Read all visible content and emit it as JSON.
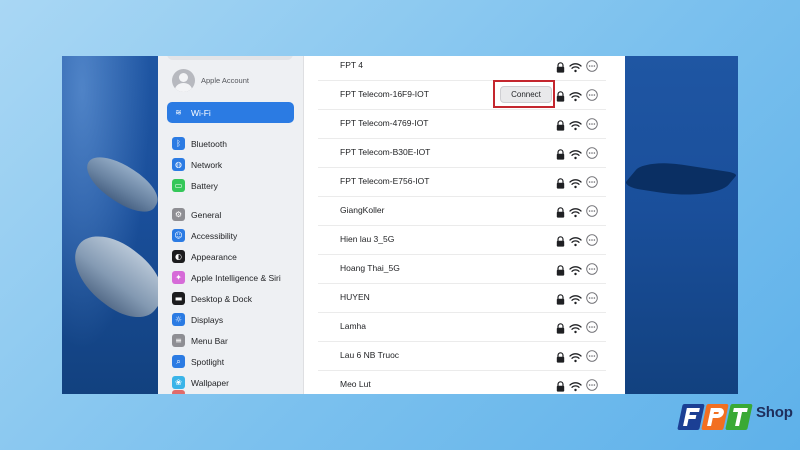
{
  "sidebar": {
    "account": {
      "label": "Apple Account"
    },
    "items": [
      {
        "label": "Wi-Fi",
        "icon": "wifi-icon",
        "color": "#2b7be3",
        "active": true
      },
      {
        "label": "Bluetooth",
        "icon": "bluetooth-icon",
        "color": "#2b7be3"
      },
      {
        "label": "Network",
        "icon": "globe-icon",
        "color": "#2b7be3"
      },
      {
        "label": "Battery",
        "icon": "battery-icon",
        "color": "#34c759"
      },
      {
        "label": "General",
        "icon": "gear-icon",
        "color": "#8e8e93"
      },
      {
        "label": "Accessibility",
        "icon": "accessibility-icon",
        "color": "#2b7be3"
      },
      {
        "label": "Appearance",
        "icon": "appearance-icon",
        "color": "#1c1c1e"
      },
      {
        "label": "Apple Intelligence & Siri",
        "icon": "siri-icon",
        "color": "#d66bd8"
      },
      {
        "label": "Desktop & Dock",
        "icon": "dock-icon",
        "color": "#1c1c1e"
      },
      {
        "label": "Displays",
        "icon": "display-icon",
        "color": "#2b7be3"
      },
      {
        "label": "Menu Bar",
        "icon": "menubar-icon",
        "color": "#8e8e93"
      },
      {
        "label": "Spotlight",
        "icon": "search-icon",
        "color": "#2b7be3"
      },
      {
        "label": "Wallpaper",
        "icon": "wallpaper-icon",
        "color": "#3ab4e8"
      }
    ]
  },
  "networks": [
    {
      "name": "FPT 4"
    },
    {
      "name": "FPT Telecom-16F9-IOT",
      "connect_label": "Connect"
    },
    {
      "name": "FPT Telecom-4769-IOT"
    },
    {
      "name": "FPT Telecom-B30E-IOT"
    },
    {
      "name": "FPT Telecom-E756-IOT"
    },
    {
      "name": "GiangKoller"
    },
    {
      "name": "Hien lau 3_5G"
    },
    {
      "name": "Hoang Thai_5G"
    },
    {
      "name": "HUYEN"
    },
    {
      "name": "Lamha"
    },
    {
      "name": "Lau 6 NB Truoc"
    },
    {
      "name": "Meo Lut"
    }
  ],
  "brand": {
    "shop_label": "Shop",
    "primary": "#1b3f94",
    "accent": "#f26f21",
    "green": "#3aa935"
  },
  "highlight_color": "#c4262e"
}
